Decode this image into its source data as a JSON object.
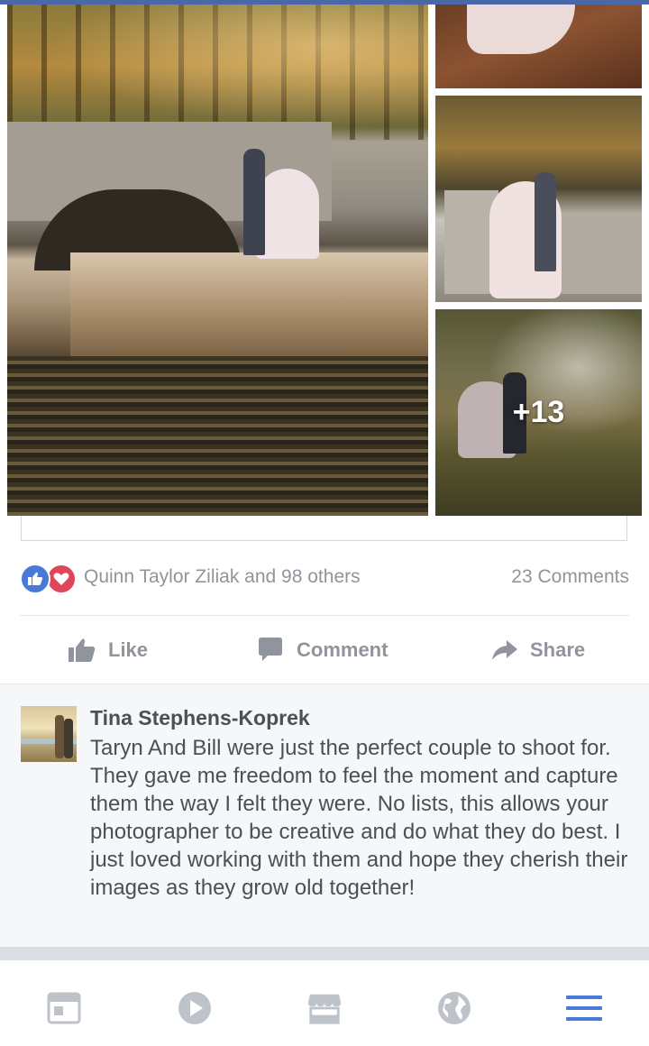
{
  "post": {
    "photos": {
      "more_count": "+13"
    },
    "reactions": {
      "names_text": "Quinn Taylor Ziliak and 98 others",
      "comments_text": "23 Comments"
    },
    "actions": {
      "like_label": "Like",
      "comment_label": "Comment",
      "share_label": "Share"
    }
  },
  "comment": {
    "author": "Tina Stephens-Koprek",
    "text": "Taryn And Bill were just the perfect couple to shoot for.  They gave me freedom to feel the moment and capture them the way I felt they were.  No lists,  this allows your photographer to be creative and do what they do best.  I just loved working with them and hope they cherish their images as they grow old together!"
  },
  "colors": {
    "accent": "#4a68a8",
    "like_blue": "#4a7ad8",
    "love_red": "#e0455a",
    "muted_text": "#90949c",
    "tab_active": "#4a7ad8",
    "tab_inactive": "#bec2c9"
  },
  "tabbar": {
    "items": [
      {
        "icon": "news-feed-icon",
        "active": false
      },
      {
        "icon": "video-play-icon",
        "active": false
      },
      {
        "icon": "marketplace-icon",
        "active": false
      },
      {
        "icon": "globe-icon",
        "active": false
      },
      {
        "icon": "menu-icon",
        "active": true
      }
    ]
  }
}
